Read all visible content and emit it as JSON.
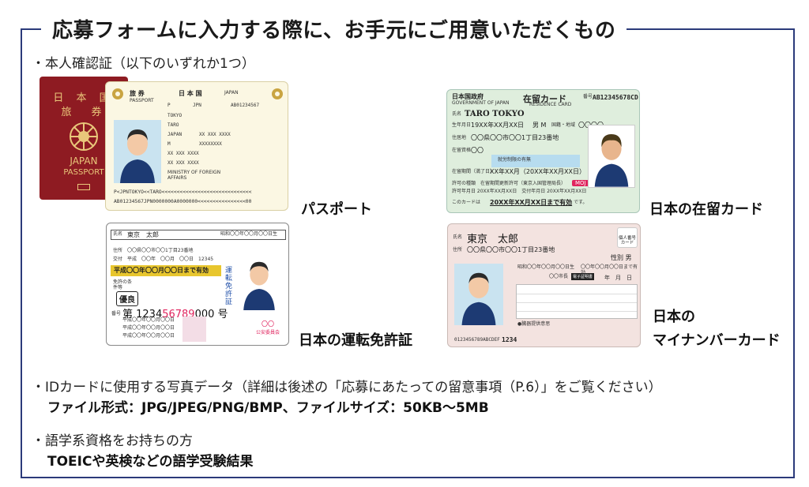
{
  "title": "応募フォームに入力する際に、お手元にご用意いただくもの",
  "section1": {
    "heading": "・本人確認証（以下のいずれか1つ）"
  },
  "section2": {
    "heading": "・IDカードに使用する写真データ（詳細は後述の「応募にあたっての留意事項（P.6）」をご覧ください）",
    "detail": "ファイル形式：JPG/JPEG/PNG/BMP、ファイルサイズ：50KB〜5MB"
  },
  "section3": {
    "heading": "・語学系資格をお持ちの方",
    "detail": "TOEICや英検などの語学受験結果"
  },
  "passport": {
    "caption": "パスポート",
    "cover_country": "日 本 国",
    "cover_word": "旅　券",
    "cover_japan": "JAPAN",
    "cover_passport": "PASSPORT",
    "page_kanji": "旅 券",
    "page_passport": "PASSPORT",
    "page_country": "日 本 国",
    "page_japan": "JAPAN",
    "type": "P",
    "code": "JPN",
    "number": "AB01234567",
    "surname": "TOKYO",
    "given": "TARO",
    "nationality": "JAPAN",
    "dob": "XX XXX XXXX",
    "sex": "M",
    "domicile": "XXXXXXXX",
    "issue": "XX XXX XXXX",
    "expiry": "XX XXX XXXX",
    "authority": "MINISTRY OF FOREIGN AFFAIRS",
    "mrz1": "P<JPNTOKYO<<TARO<<<<<<<<<<<<<<<<<<<<<<<<<<<<<<",
    "mrz2": "AB01234567JPN0000000A0000000<<<<<<<<<<<<<<<<00"
  },
  "residence": {
    "caption": "日本の在留カード",
    "gov": "日本国政府",
    "gov_en": "GOVERNMENT OF JAPAN",
    "title": "在留カード",
    "title_en": "RESIDENCE CARD",
    "no_label": "番号",
    "number": "AB12345678CD",
    "name_label": "氏名",
    "name": "TARO TOKYO",
    "dob_label": "生年月日",
    "dob": "19XX年XX月XX日",
    "sex": "男 M",
    "nat_label": "国籍・地域",
    "nat": "〇〇〇〇",
    "addr_label": "住居地",
    "addr": "〇〇県〇〇市〇〇1丁目23番地",
    "status_label": "在留資格",
    "status": "〇〇",
    "work_note": "就労制限の有無",
    "period_label": "在留期間（満了日）",
    "period": "XX年XX月（20XX年XX月XX日）",
    "permit": "許可の種類　在留期間更新許可（東京入国管理局長）",
    "permit_date": "許可年月日 20XX年XX月XX日　交付年月日 20XX年XX月XX日",
    "valid_label": "このカードは",
    "valid": "20XX年XX月XX日まで有効",
    "valid_tail": "です。",
    "moj": "MOJ"
  },
  "license": {
    "caption": "日本の運転免許証",
    "name_label": "氏名",
    "name": "東京　太郎",
    "dob": "昭和〇〇年〇〇月〇〇日生",
    "addr_label": "住所",
    "addr": "〇〇県〇〇市〇〇1丁目23番地",
    "issue_label": "交付",
    "issue": "平成　〇〇年　〇〇月　〇〇日　12345",
    "validity": "平成〇〇年〇〇月〇〇日まで有効",
    "cond_label": "免許の条件等",
    "badge": "優良",
    "num_label": "番号",
    "number_prefix": "第 1234",
    "number_highlight": "56789",
    "number_suffix": "000 号",
    "row1": "平成〇〇年〇〇月〇〇日",
    "row2": "平成〇〇年〇〇月〇〇日",
    "row3": "平成〇〇年〇〇月〇〇日",
    "side_title": "運転免許証",
    "seal_top": "〇〇",
    "seal_bottom": "公安委員会"
  },
  "mynumber": {
    "caption_line1": "日本の",
    "caption_line2": "マイナンバーカード",
    "name_label": "氏名",
    "name": "東京　太郎",
    "addr_label": "住所",
    "addr": "〇〇県〇〇市〇〇1丁目23番地",
    "badge": "個人番号カード",
    "sex": "性別 男",
    "dob": "昭和〇〇年〇〇月〇〇日生",
    "valid": "〇〇年〇〇月〇〇日まで有効",
    "issuer": "〇〇市長",
    "stamp": "電子証明書",
    "ymd": "年　月　日",
    "donor_note": "●臓器提供意思",
    "code": "0123456789ABCDEF",
    "pin": "1234"
  }
}
